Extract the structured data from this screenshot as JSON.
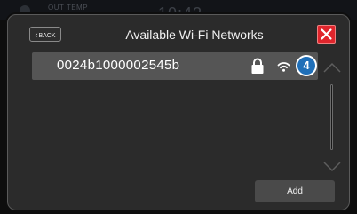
{
  "status_bar": {
    "out_temp_label": "OUT TEMP",
    "clock": "10:42"
  },
  "dialog": {
    "title": "Available Wi-Fi Networks",
    "back_label": "BACK",
    "add_label": "Add",
    "close_icon": "close-x-icon",
    "accent_close_color": "#e0252c"
  },
  "networks": [
    {
      "name": "0024b1000002545b",
      "secured": true,
      "lock_icon": "lock-icon",
      "signal_icon": "wifi-signal-icon"
    }
  ],
  "callout": {
    "number": "4",
    "color": "#1f6fb8"
  },
  "scroll": {
    "up_icon": "chevron-up-icon",
    "down_icon": "chevron-down-icon"
  }
}
